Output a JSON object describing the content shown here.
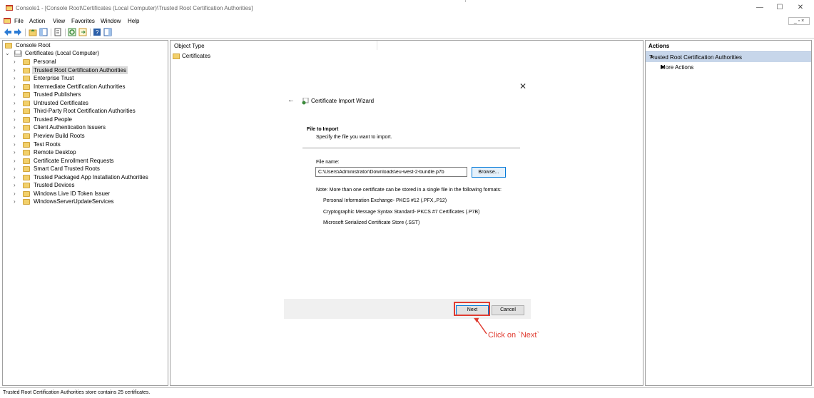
{
  "window": {
    "title": "Console1 - [Console Root\\Certificates (Local Computer)\\Trusted Root Certification Authorities]",
    "minimize": "—",
    "maximize": "☐",
    "close": "✕"
  },
  "menu": {
    "items": [
      "File",
      "Action",
      "View",
      "Favorites",
      "Window",
      "Help"
    ],
    "child_controls": "_ ▫ ×"
  },
  "tree": {
    "root": "Console Root",
    "certs": "Certificates (Local Computer)",
    "items": [
      "Personal",
      "Trusted Root Certification Authorities",
      "Enterprise Trust",
      "Intermediate Certification Authorities",
      "Trusted Publishers",
      "Untrusted Certificates",
      "Third-Party Root Certification Authorities",
      "Trusted People",
      "Client Authentication Issuers",
      "Preview Build Roots",
      "Test Roots",
      "Remote Desktop",
      "Certificate Enrollment Requests",
      "Smart Card Trusted Roots",
      "Trusted Packaged App Installation Authorities",
      "Trusted Devices",
      "Windows Live ID Token Issuer",
      "WindowsServerUpdateServices"
    ],
    "selected_index": 1
  },
  "center": {
    "column_header": "Object Type",
    "list_item": "Certificates"
  },
  "wizard": {
    "title": "Certificate Import Wizard",
    "section": "File to Import",
    "description": "Specify the file you want to import.",
    "file_name_label": "File name:",
    "file_name_value": "C:\\Users\\Administrator\\Downloads\\eu-west-2-bundle.p7b",
    "browse_label": "Browse...",
    "note": "Note:  More than one certificate can be stored in a single file in the following formats:",
    "formats": [
      "Personal Information Exchange- PKCS #12 (.PFX,.P12)",
      "Cryptographic Message Syntax Standard- PKCS #7 Certificates (.P7B)",
      "Microsoft Serialized Certificate Store (.SST)"
    ],
    "next_label": "Next",
    "cancel_label": "Cancel",
    "close_glyph": "✕",
    "back_glyph": "←"
  },
  "annotation": {
    "text": "Click on `Next`",
    "color": "#e03c31"
  },
  "actions": {
    "header": "Actions",
    "section": "Trusted Root Certification Authorities",
    "item": "More Actions"
  },
  "status": {
    "text": "Trusted Root Certification Authorities store contains 25 certificates."
  },
  "colors": {
    "selection": "#c7d6ea",
    "accent": "#0078d7",
    "folder": "#f2d06b"
  }
}
